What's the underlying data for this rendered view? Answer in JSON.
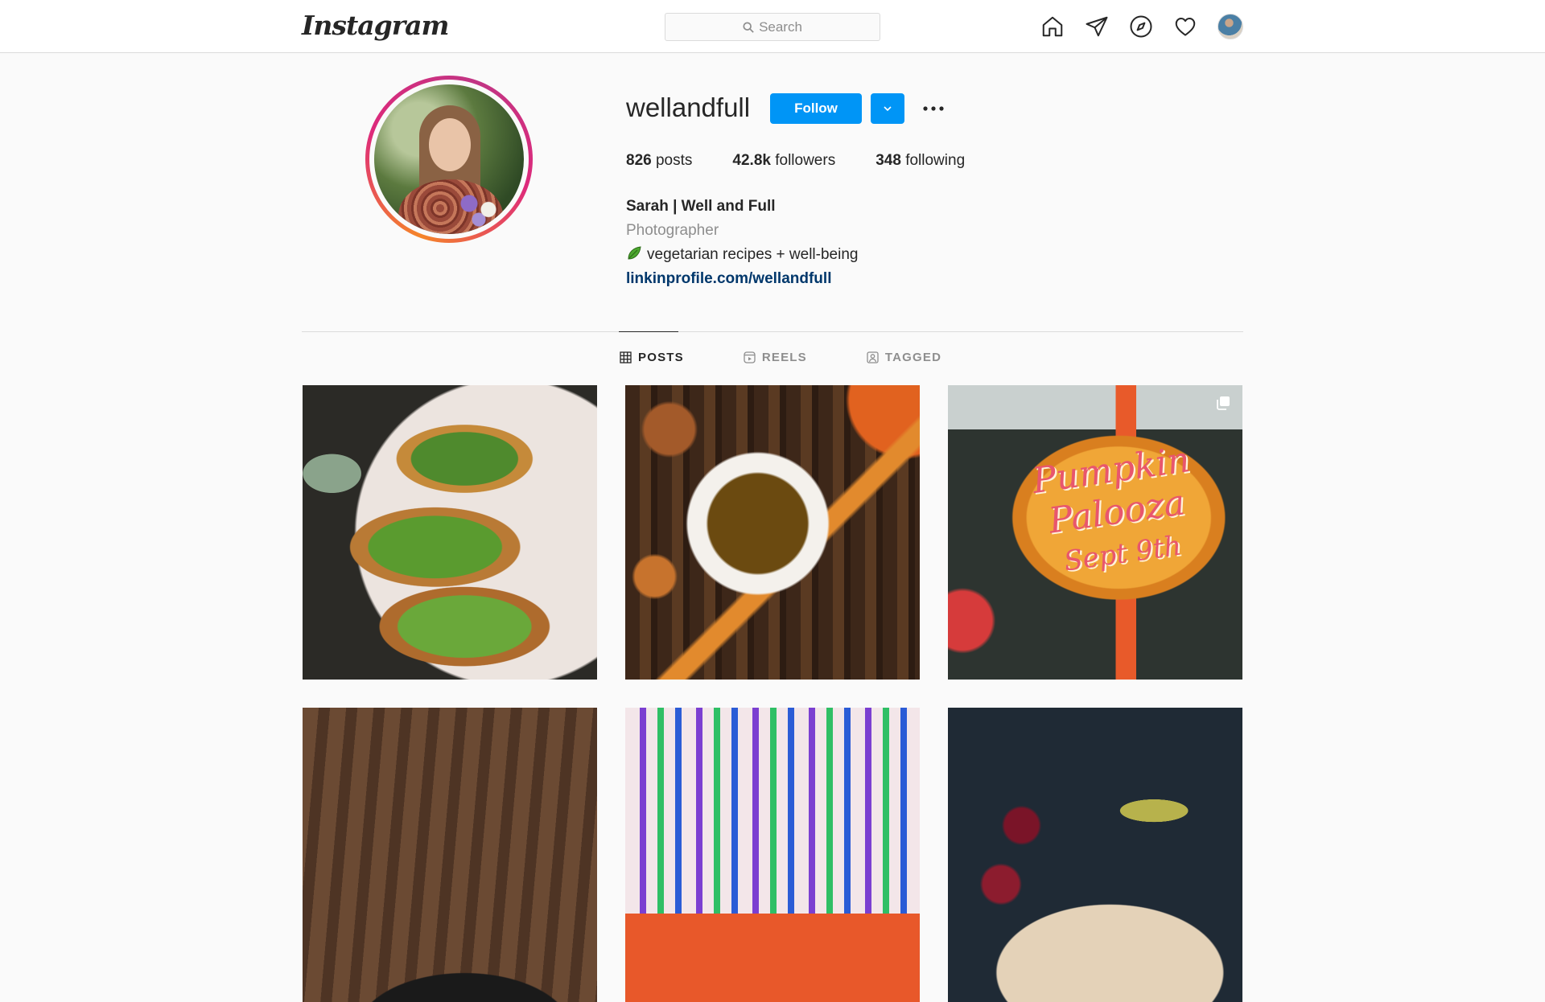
{
  "app": {
    "logo_text": "Instagram"
  },
  "search": {
    "placeholder": "Search"
  },
  "nav": {
    "icons": [
      "home-icon",
      "direct-messages-icon",
      "explore-icon",
      "activity-heart-icon",
      "profile-avatar"
    ]
  },
  "profile": {
    "username": "wellandfull",
    "follow_label": "Follow",
    "stats": {
      "posts_count": "826",
      "posts_label": "posts",
      "followers_count": "42.8k",
      "followers_label": "followers",
      "following_count": "348",
      "following_label": "following"
    },
    "display_name": "Sarah | Well and Full",
    "category": "Photographer",
    "bio_text": "vegetarian recipes + well-being",
    "bio_emoji_icon": "leaf-icon",
    "link": "linkinprofile.com/wellandfull"
  },
  "tabs": [
    {
      "label": "POSTS",
      "icon": "grid-icon",
      "active": true
    },
    {
      "label": "REELS",
      "icon": "reels-icon",
      "active": false
    },
    {
      "label": "TAGGED",
      "icon": "tagged-icon",
      "active": false
    }
  ],
  "posts": {
    "post_3_sign_line1": "Pumpkin",
    "post_3_sign_line2": "Palooza",
    "post_3_sign_line3": "Sept 9th"
  },
  "colors": {
    "accent": "#0095f6",
    "link": "#00376b",
    "ring_start": "#f58529",
    "ring_end": "#dd2a7b"
  }
}
